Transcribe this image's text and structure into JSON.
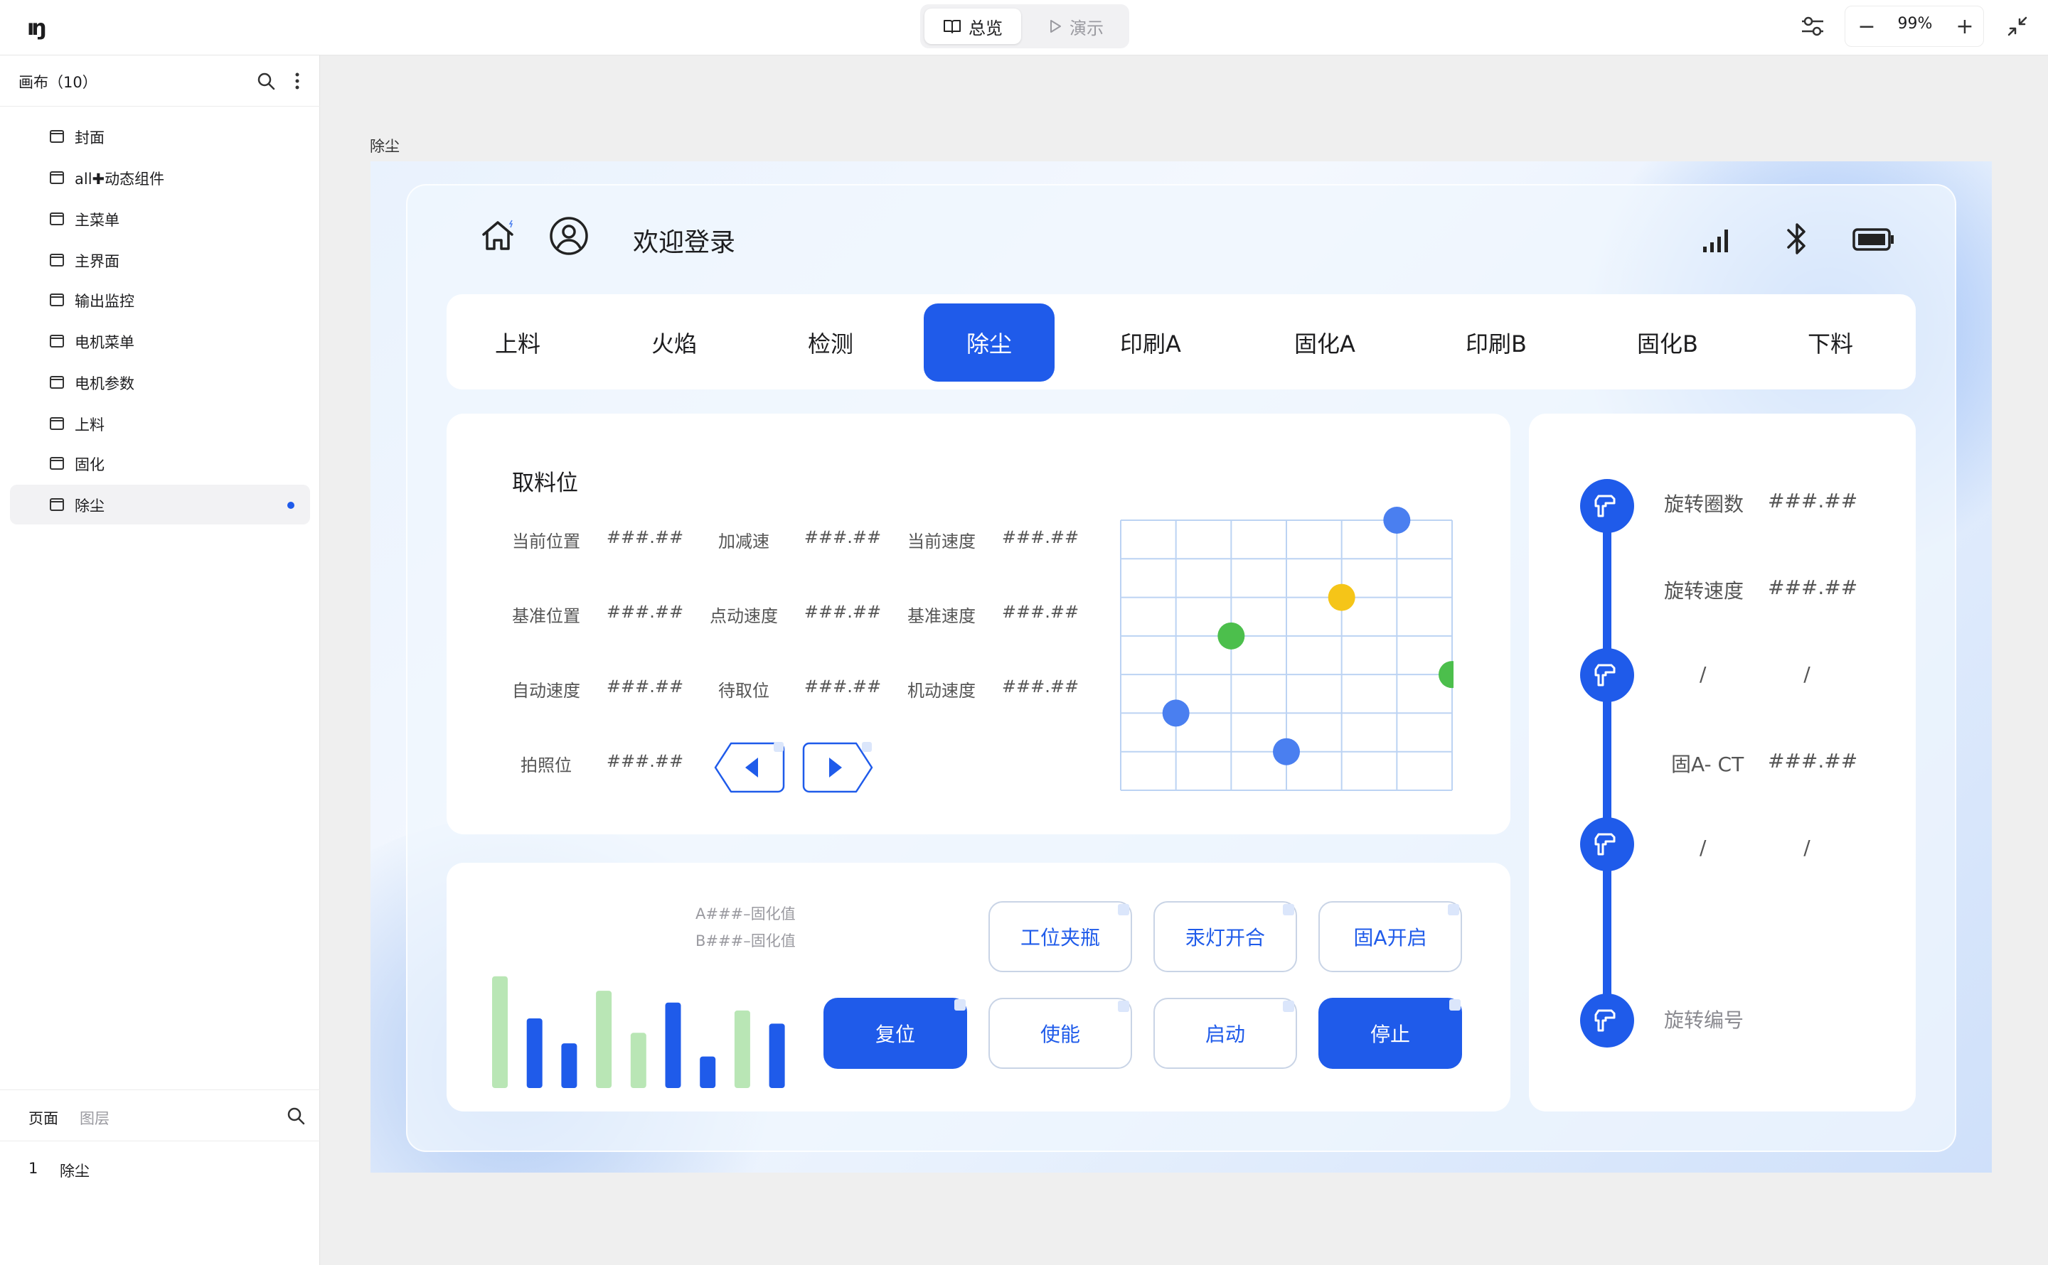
{
  "topbar": {
    "logo": "ıŋ",
    "modes": [
      {
        "label": "总览",
        "icon": "book-icon",
        "active": true
      },
      {
        "label": "演示",
        "icon": "play-icon",
        "active": false
      }
    ],
    "zoom": "99%"
  },
  "sidebar": {
    "title": "画布（10）",
    "pages": [
      {
        "label": "封面"
      },
      {
        "label": "all✚动态组件"
      },
      {
        "label": "主菜单"
      },
      {
        "label": "主界面"
      },
      {
        "label": "输出监控"
      },
      {
        "label": "电机菜单"
      },
      {
        "label": "电机参数"
      },
      {
        "label": "上料"
      },
      {
        "label": "固化"
      },
      {
        "label": "除尘",
        "active": true
      }
    ],
    "bottom_tabs": [
      "页面",
      "图层"
    ],
    "layer_index": "1",
    "layer_name": "除尘"
  },
  "canvas": {
    "frame_label": "除尘",
    "header": {
      "welcome": "欢迎登录"
    },
    "tabs": [
      "上料",
      "火焰",
      "检测",
      "除尘",
      "印刷A",
      "固化A",
      "印刷B",
      "固化B",
      "下料"
    ],
    "active_tab": "除尘",
    "pickup": {
      "title": "取料位",
      "rows": [
        [
          {
            "k": "当前位置",
            "v": "###.##"
          },
          {
            "k": "加减速",
            "v": "###.##"
          },
          {
            "k": "当前速度",
            "v": "###.##"
          }
        ],
        [
          {
            "k": "基准位置",
            "v": "###.##"
          },
          {
            "k": "点动速度",
            "v": "###.##"
          },
          {
            "k": "基准速度",
            "v": "###.##"
          }
        ],
        [
          {
            "k": "自动速度",
            "v": "###.##"
          },
          {
            "k": "待取位",
            "v": "###.##"
          },
          {
            "k": "机动速度",
            "v": "###.##"
          }
        ],
        [
          {
            "k": "拍照位",
            "v": "###.##"
          }
        ]
      ]
    },
    "scatter": {
      "points": [
        {
          "col": 5,
          "row": 0,
          "color": "#4a7ff0"
        },
        {
          "col": 4,
          "row": 2,
          "color": "#f5c518"
        },
        {
          "col": 2,
          "row": 3,
          "color": "#4cbf4c"
        },
        {
          "col": 6,
          "row": 4,
          "color": "#4cbf4c"
        },
        {
          "col": 1,
          "row": 5,
          "color": "#4a7ff0"
        },
        {
          "col": 3,
          "row": 6,
          "color": "#4a7ff0"
        }
      ],
      "cols": 6,
      "rows": 7
    },
    "controls": {
      "legend_a": "A###–固化值",
      "legend_b": "B###–固化值",
      "bars": [
        {
          "value": 0.85,
          "color": "#b9e6b5"
        },
        {
          "value": 0.53,
          "color": "#1f5bea"
        },
        {
          "value": 0.34,
          "color": "#1f5bea"
        },
        {
          "value": 0.74,
          "color": "#b9e6b5"
        },
        {
          "value": 0.42,
          "color": "#b9e6b5"
        },
        {
          "value": 0.65,
          "color": "#1f5bea"
        },
        {
          "value": 0.24,
          "color": "#1f5bea"
        },
        {
          "value": 0.59,
          "color": "#b9e6b5"
        },
        {
          "value": 0.49,
          "color": "#1f5bea"
        }
      ],
      "btn_clamp": "工位夹瓶",
      "btn_lamp": "汞灯开合",
      "btn_cure_a": "固A开启",
      "btn_reset": "复位",
      "btn_enable": "使能",
      "btn_start": "启动",
      "btn_stop": "停止"
    },
    "rotation": {
      "items": [
        {
          "k": "旋转圈数",
          "v": "###.##"
        },
        {
          "k": "旋转速度",
          "v": "###.##"
        },
        {
          "k": "/",
          "v": "/"
        },
        {
          "k": "固A- CT",
          "v": "###.##"
        },
        {
          "k": "/",
          "v": "/"
        },
        {
          "k": "旋转编号",
          "v": ""
        }
      ]
    }
  },
  "colors": {
    "accent": "#1f5bea"
  }
}
